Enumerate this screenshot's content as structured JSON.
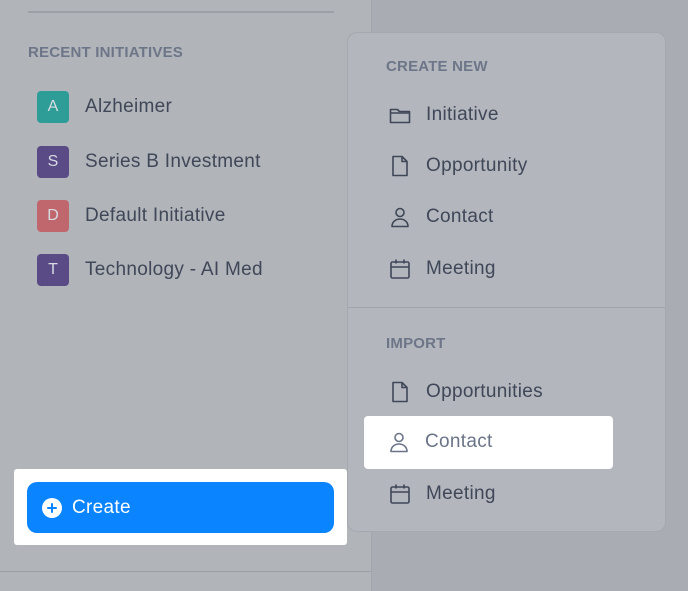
{
  "sidebar": {
    "section_heading": "RECENT INITIATIVES",
    "initiatives": [
      {
        "letter": "A",
        "label": "Alzheimer",
        "color": "#2f9d97"
      },
      {
        "letter": "S",
        "label": "Series B Investment",
        "color": "#5a4a86"
      },
      {
        "letter": "D",
        "label": "Default Initiative",
        "color": "#c0666d"
      },
      {
        "letter": "T",
        "label": "Technology - AI Med",
        "color": "#5a4a86"
      }
    ],
    "create_label": "Create"
  },
  "menu": {
    "create_heading": "CREATE NEW",
    "create_items": [
      {
        "label": "Initiative",
        "icon": "folder-icon"
      },
      {
        "label": "Opportunity",
        "icon": "file-icon"
      },
      {
        "label": "Contact",
        "icon": "person-icon"
      },
      {
        "label": "Meeting",
        "icon": "calendar-icon"
      }
    ],
    "import_heading": "IMPORT",
    "import_items": [
      {
        "label": "Opportunities",
        "icon": "file-icon"
      },
      {
        "label": "Contact",
        "icon": "person-icon",
        "highlighted": true
      },
      {
        "label": "Meeting",
        "icon": "calendar-icon"
      }
    ]
  },
  "colors": {
    "accent": "#0a84ff",
    "text": "#3f4758",
    "heading": "#6d7688"
  }
}
